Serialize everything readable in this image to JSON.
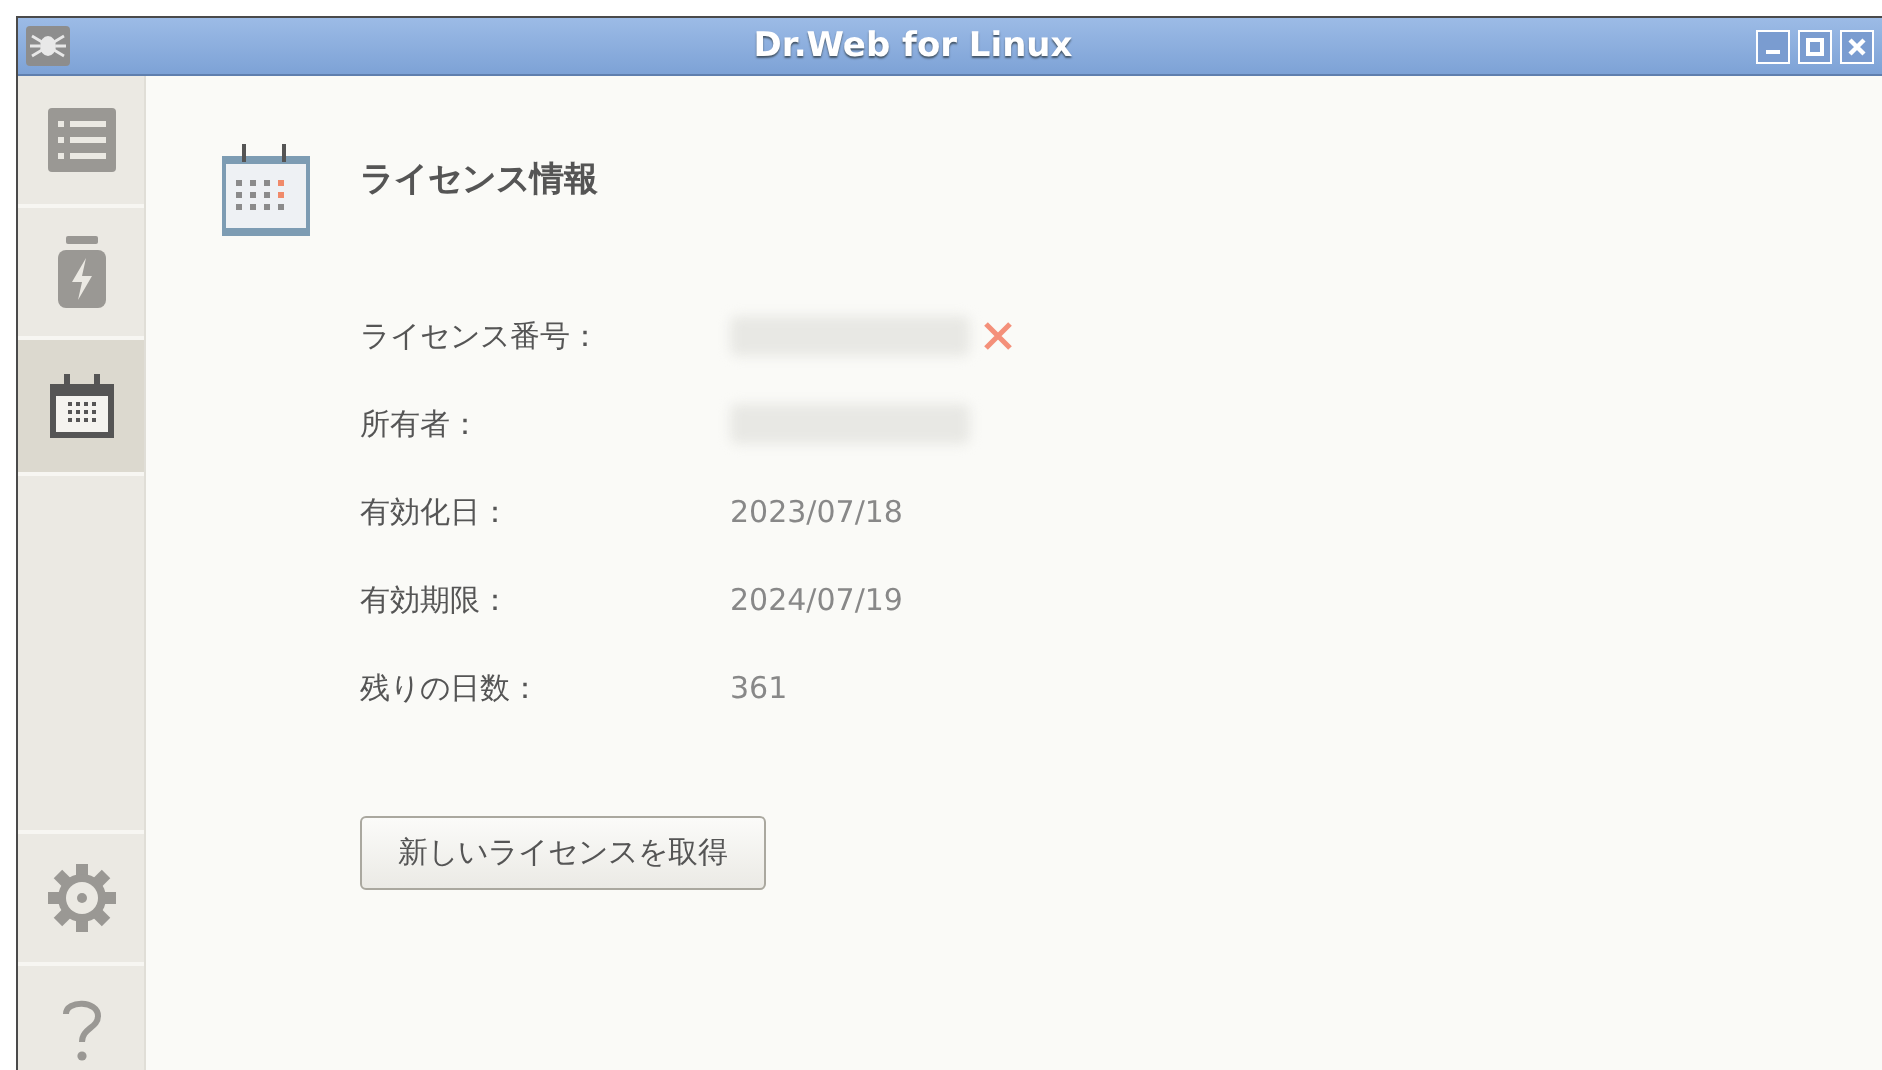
{
  "window": {
    "title": "Dr.Web for Linux"
  },
  "sidebar": {
    "items": [
      {
        "kind": "list",
        "selected": false
      },
      {
        "kind": "battery",
        "selected": false
      },
      {
        "kind": "calendar",
        "selected": true
      }
    ],
    "bottom_items": [
      {
        "kind": "settings",
        "selected": false
      },
      {
        "kind": "help",
        "selected": false
      }
    ]
  },
  "license": {
    "heading": "ライセンス情報",
    "rows": [
      {
        "label": "ライセンス番号：",
        "redacted": true,
        "invalid": true
      },
      {
        "label": "所有者：",
        "redacted": true,
        "invalid": false
      },
      {
        "label": "有効化日：",
        "value": "2023/07/18",
        "redacted": false,
        "invalid": false
      },
      {
        "label": "有効期限：",
        "value": "2024/07/19",
        "redacted": false,
        "invalid": false
      },
      {
        "label": "残りの日数：",
        "value": "361",
        "redacted": false,
        "invalid": false
      }
    ],
    "button": "新しいライセンスを取得"
  }
}
